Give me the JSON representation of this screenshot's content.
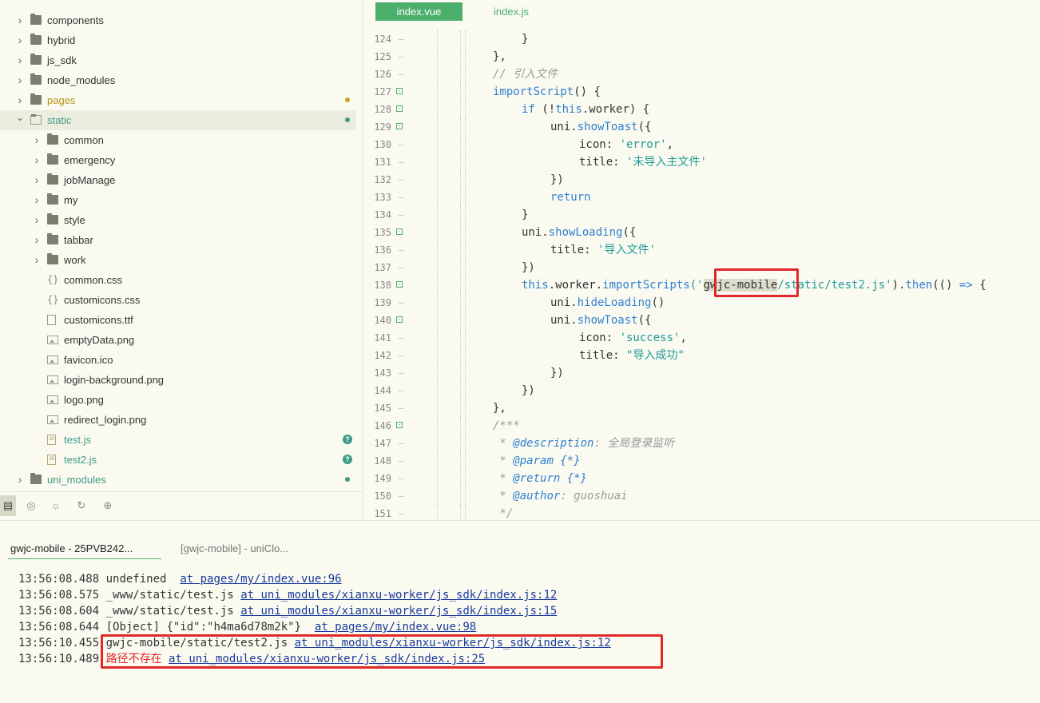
{
  "sidebar": {
    "items": [
      {
        "label": "components",
        "depth": 0,
        "type": "folder",
        "expanded": false,
        "status": ""
      },
      {
        "label": "hybrid",
        "depth": 0,
        "type": "folder",
        "expanded": false,
        "status": ""
      },
      {
        "label": "js_sdk",
        "depth": 0,
        "type": "folder",
        "expanded": false,
        "status": ""
      },
      {
        "label": "node_modules",
        "depth": 0,
        "type": "folder",
        "expanded": false,
        "status": ""
      },
      {
        "label": "pages",
        "depth": 0,
        "type": "folder",
        "expanded": false,
        "status": "modified"
      },
      {
        "label": "static",
        "depth": 0,
        "type": "folder",
        "expanded": true,
        "status": "untracked",
        "selected": true
      },
      {
        "label": "common",
        "depth": 1,
        "type": "folder",
        "expanded": false,
        "status": ""
      },
      {
        "label": "emergency",
        "depth": 1,
        "type": "folder",
        "expanded": false,
        "status": ""
      },
      {
        "label": "jobManage",
        "depth": 1,
        "type": "folder",
        "expanded": false,
        "status": ""
      },
      {
        "label": "my",
        "depth": 1,
        "type": "folder",
        "expanded": false,
        "status": ""
      },
      {
        "label": "style",
        "depth": 1,
        "type": "folder",
        "expanded": false,
        "status": ""
      },
      {
        "label": "tabbar",
        "depth": 1,
        "type": "folder",
        "expanded": false,
        "status": ""
      },
      {
        "label": "work",
        "depth": 1,
        "type": "folder",
        "expanded": false,
        "status": ""
      },
      {
        "label": "common.css",
        "depth": 1,
        "type": "css",
        "status": ""
      },
      {
        "label": "customicons.css",
        "depth": 1,
        "type": "css",
        "status": ""
      },
      {
        "label": "customicons.ttf",
        "depth": 1,
        "type": "file",
        "status": ""
      },
      {
        "label": "emptyData.png",
        "depth": 1,
        "type": "image",
        "status": ""
      },
      {
        "label": "favicon.ico",
        "depth": 1,
        "type": "image",
        "status": ""
      },
      {
        "label": "login-background.png",
        "depth": 1,
        "type": "image",
        "status": ""
      },
      {
        "label": "logo.png",
        "depth": 1,
        "type": "image",
        "status": ""
      },
      {
        "label": "redirect_login.png",
        "depth": 1,
        "type": "image",
        "status": ""
      },
      {
        "label": "test.js",
        "depth": 1,
        "type": "js",
        "status": "new"
      },
      {
        "label": "test2.js",
        "depth": 1,
        "type": "js",
        "status": "new"
      },
      {
        "label": "uni_modules",
        "depth": 0,
        "type": "folder",
        "expanded": false,
        "status": "untracked"
      }
    ],
    "toolbar_icons": [
      "project-icon",
      "binoculars-icon",
      "bug-icon",
      "git-icon",
      "globe-icon"
    ]
  },
  "colors": {
    "accent": "#4caf6b",
    "modified_dot": "#c9a227",
    "untracked_dot": "#3f9a86",
    "highlight_red": "#e0282a",
    "link": "#1a3aa0"
  },
  "editor": {
    "tabs": [
      {
        "label": "index.vue",
        "active": true
      },
      {
        "label": "index.js",
        "active": false
      }
    ],
    "lines": [
      {
        "n": "124",
        "indent": 4,
        "fold": false,
        "tokens": [
          {
            "t": "}",
            "c": "p"
          }
        ]
      },
      {
        "n": "125",
        "indent": 3,
        "fold": false,
        "tokens": [
          {
            "t": "},",
            "c": "p"
          }
        ]
      },
      {
        "n": "126",
        "indent": 3,
        "fold": false,
        "tokens": [
          {
            "t": "// 引入文件",
            "c": "cm"
          }
        ]
      },
      {
        "n": "127",
        "indent": 3,
        "fold": true,
        "tokens": [
          {
            "t": "importScript",
            "c": "fn"
          },
          {
            "t": "() {",
            "c": "p"
          }
        ]
      },
      {
        "n": "128",
        "indent": 4,
        "fold": true,
        "tokens": [
          {
            "t": "if",
            "c": "kw"
          },
          {
            "t": " (!",
            "c": "p"
          },
          {
            "t": "this",
            "c": "kw"
          },
          {
            "t": ".worker) {",
            "c": "p"
          }
        ]
      },
      {
        "n": "129",
        "indent": 5,
        "fold": true,
        "tokens": [
          {
            "t": "uni.",
            "c": "p"
          },
          {
            "t": "showToast",
            "c": "fn"
          },
          {
            "t": "({",
            "c": "p"
          }
        ]
      },
      {
        "n": "130",
        "indent": 6,
        "fold": false,
        "tokens": [
          {
            "t": "icon: ",
            "c": "p"
          },
          {
            "t": "'error'",
            "c": "str"
          },
          {
            "t": ",",
            "c": "p"
          }
        ]
      },
      {
        "n": "131",
        "indent": 6,
        "fold": false,
        "tokens": [
          {
            "t": "title: ",
            "c": "p"
          },
          {
            "t": "'未导入主文件'",
            "c": "str"
          }
        ]
      },
      {
        "n": "132",
        "indent": 5,
        "fold": false,
        "tokens": [
          {
            "t": "})",
            "c": "p"
          }
        ]
      },
      {
        "n": "133",
        "indent": 5,
        "fold": false,
        "tokens": [
          {
            "t": "return",
            "c": "kw"
          }
        ]
      },
      {
        "n": "134",
        "indent": 4,
        "fold": false,
        "tokens": [
          {
            "t": "}",
            "c": "p"
          }
        ]
      },
      {
        "n": "135",
        "indent": 4,
        "fold": true,
        "tokens": [
          {
            "t": "uni.",
            "c": "p"
          },
          {
            "t": "showLoading",
            "c": "fn"
          },
          {
            "t": "({",
            "c": "p"
          }
        ]
      },
      {
        "n": "136",
        "indent": 5,
        "fold": false,
        "tokens": [
          {
            "t": "title: ",
            "c": "p"
          },
          {
            "t": "'导入文件'",
            "c": "str"
          }
        ]
      },
      {
        "n": "137",
        "indent": 4,
        "fold": false,
        "tokens": [
          {
            "t": "})",
            "c": "p"
          }
        ]
      },
      {
        "n": "138",
        "indent": 4,
        "fold": true,
        "tokens": [
          {
            "t": "this",
            "c": "kw"
          },
          {
            "t": ".worker.",
            "c": "p"
          },
          {
            "t": "importScripts",
            "c": "fn"
          },
          {
            "t": "('",
            "c": "str"
          },
          {
            "t": "gwjc-mobile",
            "c": "hl"
          },
          {
            "t": "/static/test2.js'",
            "c": "str"
          },
          {
            "t": ").",
            "c": "p"
          },
          {
            "t": "then",
            "c": "fn"
          },
          {
            "t": "(() ",
            "c": "p"
          },
          {
            "t": "=>",
            "c": "kw"
          },
          {
            "t": " {",
            "c": "p"
          }
        ]
      },
      {
        "n": "139",
        "indent": 5,
        "fold": false,
        "tokens": [
          {
            "t": "uni.",
            "c": "p"
          },
          {
            "t": "hideLoading",
            "c": "fn"
          },
          {
            "t": "()",
            "c": "p"
          }
        ]
      },
      {
        "n": "140",
        "indent": 5,
        "fold": true,
        "tokens": [
          {
            "t": "uni.",
            "c": "p"
          },
          {
            "t": "showToast",
            "c": "fn"
          },
          {
            "t": "({",
            "c": "p"
          }
        ]
      },
      {
        "n": "141",
        "indent": 6,
        "fold": false,
        "tokens": [
          {
            "t": "icon: ",
            "c": "p"
          },
          {
            "t": "'success'",
            "c": "str"
          },
          {
            "t": ",",
            "c": "p"
          }
        ]
      },
      {
        "n": "142",
        "indent": 6,
        "fold": false,
        "tokens": [
          {
            "t": "title: ",
            "c": "p"
          },
          {
            "t": "\"导入成功\"",
            "c": "str"
          }
        ]
      },
      {
        "n": "143",
        "indent": 5,
        "fold": false,
        "tokens": [
          {
            "t": "})",
            "c": "p"
          }
        ]
      },
      {
        "n": "144",
        "indent": 4,
        "fold": false,
        "tokens": [
          {
            "t": "})",
            "c": "p"
          }
        ]
      },
      {
        "n": "145",
        "indent": 3,
        "fold": false,
        "tokens": [
          {
            "t": "},",
            "c": "p"
          }
        ]
      },
      {
        "n": "146",
        "indent": 3,
        "fold": true,
        "tokens": [
          {
            "t": "/***",
            "c": "cm"
          }
        ]
      },
      {
        "n": "147",
        "indent": 3,
        "fold": false,
        "tokens": [
          {
            "t": " * ",
            "c": "cm"
          },
          {
            "t": "@description",
            "c": "doc"
          },
          {
            "t": ": 全局登录监听",
            "c": "cm"
          }
        ]
      },
      {
        "n": "148",
        "indent": 3,
        "fold": false,
        "tokens": [
          {
            "t": " * ",
            "c": "cm"
          },
          {
            "t": "@param",
            "c": "doc"
          },
          {
            "t": " {*}",
            "c": "doc"
          }
        ]
      },
      {
        "n": "149",
        "indent": 3,
        "fold": false,
        "tokens": [
          {
            "t": " * ",
            "c": "cm"
          },
          {
            "t": "@return",
            "c": "doc"
          },
          {
            "t": " {*}",
            "c": "doc"
          }
        ]
      },
      {
        "n": "150",
        "indent": 3,
        "fold": false,
        "tokens": [
          {
            "t": " * ",
            "c": "cm"
          },
          {
            "t": "@author",
            "c": "doc"
          },
          {
            "t": ": guoshuai",
            "c": "cm"
          }
        ]
      },
      {
        "n": "151",
        "indent": 3,
        "fold": false,
        "tokens": [
          {
            "t": " */",
            "c": "cm"
          }
        ]
      }
    ]
  },
  "console": {
    "tabs": [
      {
        "label": "gwjc-mobile - 25PVB242...",
        "active": true
      },
      {
        "label": "[gwjc-mobile] - uniClo...",
        "active": false
      }
    ],
    "logs": [
      {
        "time": "13:56:08.488",
        "msg": "undefined",
        "msg_class": "",
        "sep": "  ",
        "link": "at pages/my/index.vue:96"
      },
      {
        "time": "13:56:08.575",
        "msg": "_www/static/test.js",
        "msg_class": "",
        "sep": " ",
        "link": "at uni_modules/xianxu-worker/js_sdk/index.js:12"
      },
      {
        "time": "13:56:08.604",
        "msg": "_www/static/test.js",
        "msg_class": "",
        "sep": " ",
        "link": "at uni_modules/xianxu-worker/js_sdk/index.js:15"
      },
      {
        "time": "13:56:08.644",
        "msg": "[Object] {\"id\":\"h4ma6d78m2k\"}",
        "msg_class": "",
        "sep": "  ",
        "link": "at pages/my/index.vue:98"
      },
      {
        "time": "13:56:10.455",
        "msg": "gwjc-mobile/static/test2.js",
        "msg_class": "",
        "sep": " ",
        "link": "at uni_modules/xianxu-worker/js_sdk/index.js:12"
      },
      {
        "time": "13:56:10.489",
        "msg": "路径不存在",
        "msg_class": "err",
        "sep": " ",
        "link": "at uni_modules/xianxu-worker/js_sdk/index.js:25"
      }
    ]
  }
}
